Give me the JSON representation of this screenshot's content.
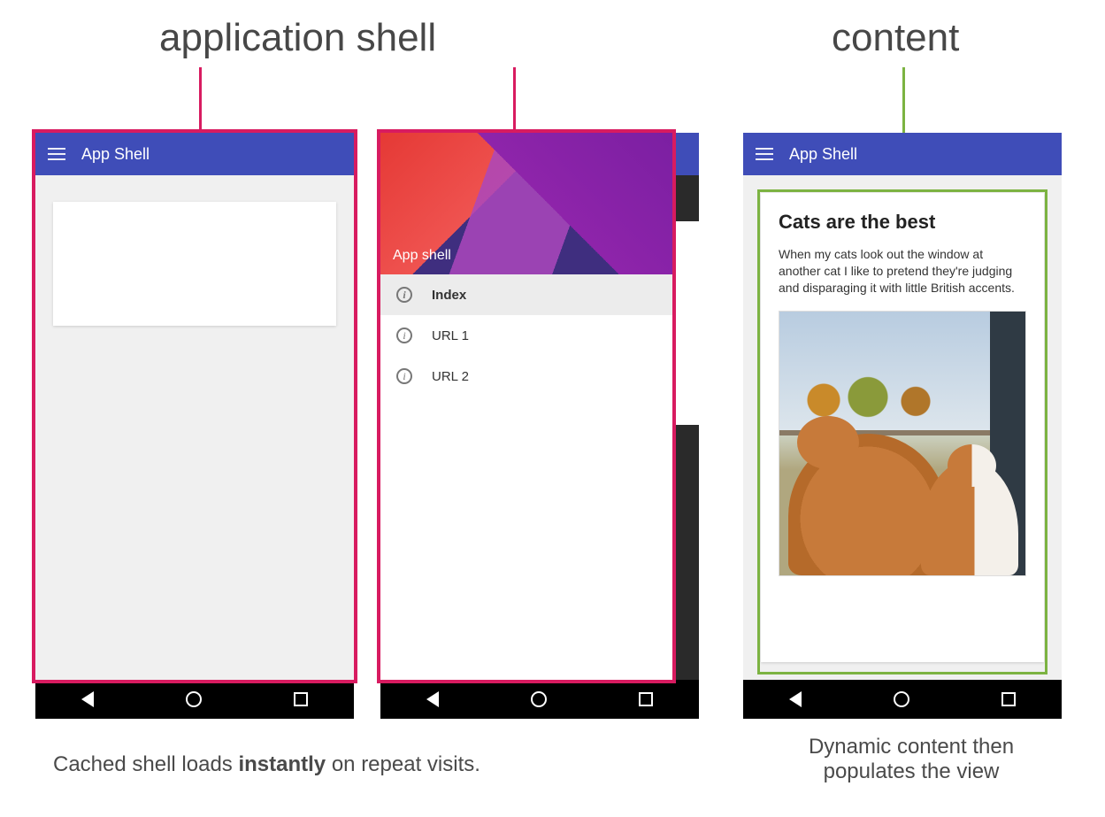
{
  "headings": {
    "app_shell": "application shell",
    "content": "content"
  },
  "colors": {
    "pink_frame": "#d81b60",
    "green_frame": "#7cb342",
    "appbar": "#3f4db8"
  },
  "appbar": {
    "title": "App Shell"
  },
  "drawer": {
    "header_label": "App shell",
    "items": [
      {
        "label": "Index",
        "selected": true
      },
      {
        "label": "URL 1",
        "selected": false
      },
      {
        "label": "URL 2",
        "selected": false
      }
    ]
  },
  "article": {
    "title": "Cats are the best",
    "body": "When my cats look out the window at another cat I like to pretend they're judging and disparaging it with little British accents.",
    "image_alt": "Two orange-and-white cats looking out a window at autumn trees"
  },
  "captions": {
    "left_a": "Cached shell loads ",
    "left_b": "instantly",
    "left_c": " on repeat visits.",
    "right_a": "Dynamic content then",
    "right_b": "populates the view"
  },
  "nav_icons": {
    "back": "back-triangle",
    "home": "home-circle",
    "recent": "recent-square"
  }
}
